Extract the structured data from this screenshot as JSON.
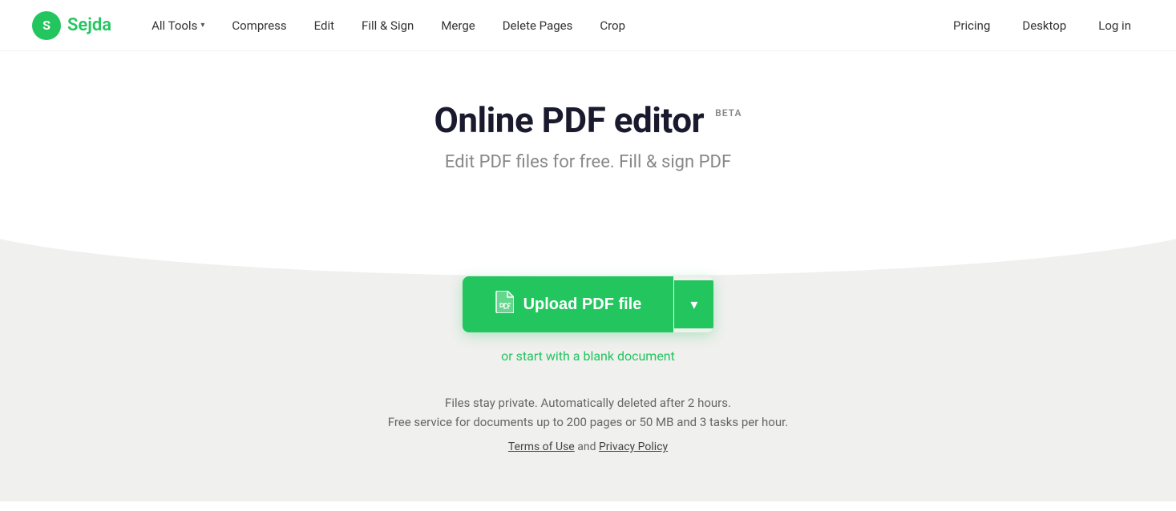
{
  "brand": {
    "logo_letter": "S",
    "logo_name": "Sejda"
  },
  "navbar": {
    "all_tools_label": "All Tools",
    "compress_label": "Compress",
    "edit_label": "Edit",
    "fill_sign_label": "Fill & Sign",
    "merge_label": "Merge",
    "delete_pages_label": "Delete Pages",
    "crop_label": "Crop",
    "pricing_label": "Pricing",
    "desktop_label": "Desktop",
    "login_label": "Log in"
  },
  "hero": {
    "title": "Online PDF editor",
    "beta": "BETA",
    "subtitle": "Edit PDF files for free. Fill & sign PDF"
  },
  "upload": {
    "button_label": "Upload PDF file",
    "dropdown_arrow": "▾",
    "blank_doc_link": "or start with a blank document"
  },
  "privacy": {
    "line1": "Files stay private. Automatically deleted after 2 hours.",
    "line2": "Free service for documents up to 200 pages or 50 MB and 3 tasks per hour.",
    "terms_text": "and",
    "terms_link": "Terms of Use",
    "privacy_link": "Privacy Policy"
  }
}
